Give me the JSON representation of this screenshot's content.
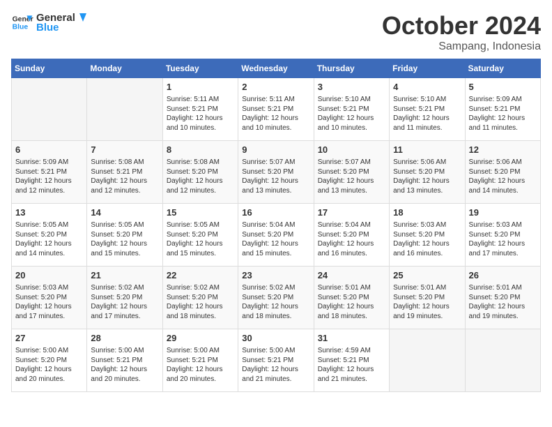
{
  "logo": {
    "line1": "General",
    "line2": "Blue"
  },
  "header": {
    "title": "October 2024",
    "subtitle": "Sampang, Indonesia"
  },
  "weekdays": [
    "Sunday",
    "Monday",
    "Tuesday",
    "Wednesday",
    "Thursday",
    "Friday",
    "Saturday"
  ],
  "weeks": [
    [
      {
        "day": "",
        "info": ""
      },
      {
        "day": "",
        "info": ""
      },
      {
        "day": "1",
        "info": "Sunrise: 5:11 AM\nSunset: 5:21 PM\nDaylight: 12 hours\nand 10 minutes."
      },
      {
        "day": "2",
        "info": "Sunrise: 5:11 AM\nSunset: 5:21 PM\nDaylight: 12 hours\nand 10 minutes."
      },
      {
        "day": "3",
        "info": "Sunrise: 5:10 AM\nSunset: 5:21 PM\nDaylight: 12 hours\nand 10 minutes."
      },
      {
        "day": "4",
        "info": "Sunrise: 5:10 AM\nSunset: 5:21 PM\nDaylight: 12 hours\nand 11 minutes."
      },
      {
        "day": "5",
        "info": "Sunrise: 5:09 AM\nSunset: 5:21 PM\nDaylight: 12 hours\nand 11 minutes."
      }
    ],
    [
      {
        "day": "6",
        "info": "Sunrise: 5:09 AM\nSunset: 5:21 PM\nDaylight: 12 hours\nand 12 minutes."
      },
      {
        "day": "7",
        "info": "Sunrise: 5:08 AM\nSunset: 5:21 PM\nDaylight: 12 hours\nand 12 minutes."
      },
      {
        "day": "8",
        "info": "Sunrise: 5:08 AM\nSunset: 5:20 PM\nDaylight: 12 hours\nand 12 minutes."
      },
      {
        "day": "9",
        "info": "Sunrise: 5:07 AM\nSunset: 5:20 PM\nDaylight: 12 hours\nand 13 minutes."
      },
      {
        "day": "10",
        "info": "Sunrise: 5:07 AM\nSunset: 5:20 PM\nDaylight: 12 hours\nand 13 minutes."
      },
      {
        "day": "11",
        "info": "Sunrise: 5:06 AM\nSunset: 5:20 PM\nDaylight: 12 hours\nand 13 minutes."
      },
      {
        "day": "12",
        "info": "Sunrise: 5:06 AM\nSunset: 5:20 PM\nDaylight: 12 hours\nand 14 minutes."
      }
    ],
    [
      {
        "day": "13",
        "info": "Sunrise: 5:05 AM\nSunset: 5:20 PM\nDaylight: 12 hours\nand 14 minutes."
      },
      {
        "day": "14",
        "info": "Sunrise: 5:05 AM\nSunset: 5:20 PM\nDaylight: 12 hours\nand 15 minutes."
      },
      {
        "day": "15",
        "info": "Sunrise: 5:05 AM\nSunset: 5:20 PM\nDaylight: 12 hours\nand 15 minutes."
      },
      {
        "day": "16",
        "info": "Sunrise: 5:04 AM\nSunset: 5:20 PM\nDaylight: 12 hours\nand 15 minutes."
      },
      {
        "day": "17",
        "info": "Sunrise: 5:04 AM\nSunset: 5:20 PM\nDaylight: 12 hours\nand 16 minutes."
      },
      {
        "day": "18",
        "info": "Sunrise: 5:03 AM\nSunset: 5:20 PM\nDaylight: 12 hours\nand 16 minutes."
      },
      {
        "day": "19",
        "info": "Sunrise: 5:03 AM\nSunset: 5:20 PM\nDaylight: 12 hours\nand 17 minutes."
      }
    ],
    [
      {
        "day": "20",
        "info": "Sunrise: 5:03 AM\nSunset: 5:20 PM\nDaylight: 12 hours\nand 17 minutes."
      },
      {
        "day": "21",
        "info": "Sunrise: 5:02 AM\nSunset: 5:20 PM\nDaylight: 12 hours\nand 17 minutes."
      },
      {
        "day": "22",
        "info": "Sunrise: 5:02 AM\nSunset: 5:20 PM\nDaylight: 12 hours\nand 18 minutes."
      },
      {
        "day": "23",
        "info": "Sunrise: 5:02 AM\nSunset: 5:20 PM\nDaylight: 12 hours\nand 18 minutes."
      },
      {
        "day": "24",
        "info": "Sunrise: 5:01 AM\nSunset: 5:20 PM\nDaylight: 12 hours\nand 18 minutes."
      },
      {
        "day": "25",
        "info": "Sunrise: 5:01 AM\nSunset: 5:20 PM\nDaylight: 12 hours\nand 19 minutes."
      },
      {
        "day": "26",
        "info": "Sunrise: 5:01 AM\nSunset: 5:20 PM\nDaylight: 12 hours\nand 19 minutes."
      }
    ],
    [
      {
        "day": "27",
        "info": "Sunrise: 5:00 AM\nSunset: 5:20 PM\nDaylight: 12 hours\nand 20 minutes."
      },
      {
        "day": "28",
        "info": "Sunrise: 5:00 AM\nSunset: 5:21 PM\nDaylight: 12 hours\nand 20 minutes."
      },
      {
        "day": "29",
        "info": "Sunrise: 5:00 AM\nSunset: 5:21 PM\nDaylight: 12 hours\nand 20 minutes."
      },
      {
        "day": "30",
        "info": "Sunrise: 5:00 AM\nSunset: 5:21 PM\nDaylight: 12 hours\nand 21 minutes."
      },
      {
        "day": "31",
        "info": "Sunrise: 4:59 AM\nSunset: 5:21 PM\nDaylight: 12 hours\nand 21 minutes."
      },
      {
        "day": "",
        "info": ""
      },
      {
        "day": "",
        "info": ""
      }
    ]
  ]
}
